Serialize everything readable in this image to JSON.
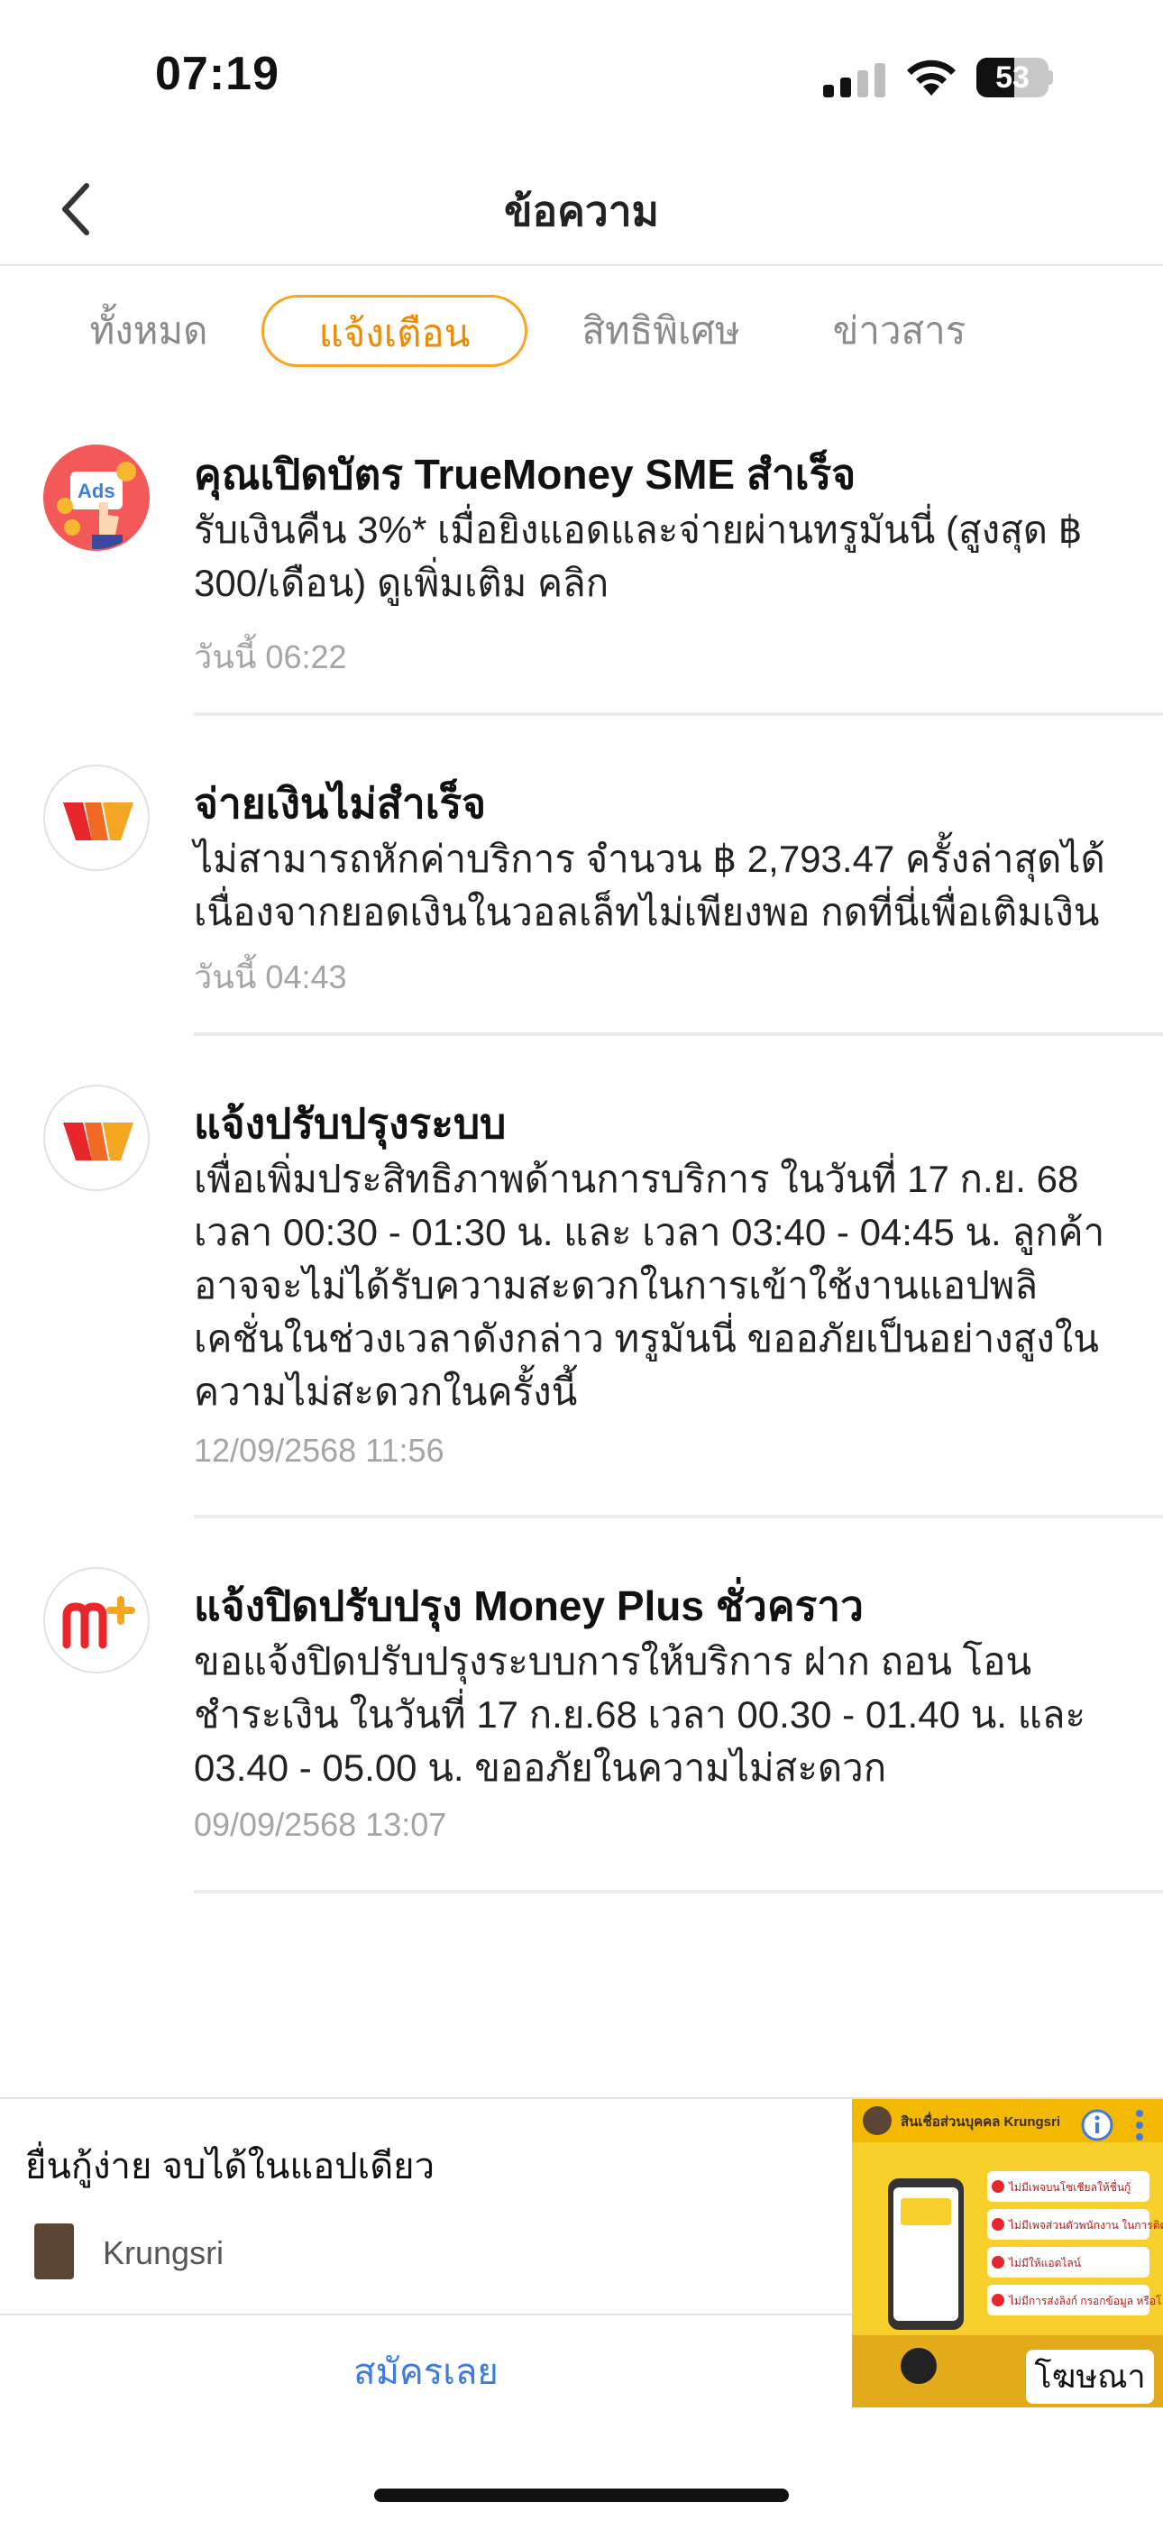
{
  "status_bar": {
    "time": "07:19",
    "battery_percent": "53",
    "battery_level": 0.53
  },
  "header": {
    "title": "ข้อความ"
  },
  "tabs": [
    {
      "label": "ทั้งหมด",
      "active": false
    },
    {
      "label": "แจ้งเตือน",
      "active": true
    },
    {
      "label": "สิทธิพิเศษ",
      "active": false
    },
    {
      "label": "ข่าวสาร",
      "active": false
    }
  ],
  "notifications": [
    {
      "icon": "ads-promo-icon",
      "title": "คุณเปิดบัตร TrueMoney SME สำเร็จ",
      "body": "รับเงินคืน 3%* เมื่อยิงแอดและจ่ายผ่านทรูมันนี่ (สูงสุด ฿ 300/เดือน) ดูเพิ่มเติม คลิก",
      "time": "วันนี้ 06:22"
    },
    {
      "icon": "truemoney-wallet-icon",
      "title": "จ่ายเงินไม่สำเร็จ",
      "body": "ไม่สามารถหักค่าบริการ จำนวน ฿ 2,793.47 ครั้งล่าสุดได้ เนื่องจากยอดเงินในวอลเล็ทไม่เพียงพอ กดที่นี่เพื่อเติมเงิน",
      "time": "วันนี้ 04:43"
    },
    {
      "icon": "truemoney-wallet-icon",
      "title": "แจ้งปรับปรุงระบบ",
      "body": "เพื่อเพิ่มประสิทธิภาพด้านการบริการ ในวันที่ 17 ก.ย. 68 เวลา 00:30 - 01:30 น. และ เวลา 03:40 - 04:45 น. ลูกค้าอาจจะไม่ได้รับความสะดวกในการเข้าใช้งานแอปพลิเคชั่นในช่วงเวลาดังกล่าว ทรูมันนี่ ขออภัยเป็นอย่างสูงในความไม่สะดวกในครั้งนี้",
      "time": "12/09/2568 11:56"
    },
    {
      "icon": "money-plus-icon",
      "title": "แจ้งปิดปรับปรุง Money Plus ชั่วคราว",
      "body": "ขอแจ้งปิดปรับปรุงระบบการให้บริการ ฝาก ถอน โอน ชำระเงิน ในวันที่ 17 ก.ย.68 เวลา 00.30 - 01.40 น. และ 03.40 - 05.00 น. ขออภัยในความไม่สะดวก",
      "time": "09/09/2568 13:07"
    }
  ],
  "ad": {
    "headline": "ยื่นกู้ง่าย จบได้ในแอปเดียว",
    "brand": "Krungsri",
    "cta": "สมัครเลย",
    "label": "โฆษณา",
    "image_title": "สินเชื่อส่วนบุคคล Krungsri",
    "image_points": [
      "ไม่มีเพจบนโซเชียลให้ชื่นกู้",
      "ไม่มีเพจส่วนตัวพนักงาน ในการติดต่อ",
      "ไม่มีให้แอดไลน์",
      "ไม่มีการส่งลิงก์ กรอกข้อมูล หรือโอนเงิน"
    ]
  }
}
